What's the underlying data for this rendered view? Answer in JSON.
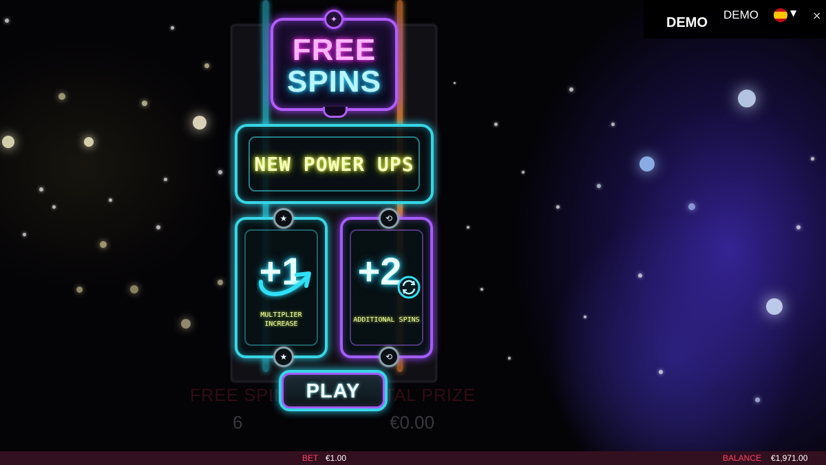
{
  "logo": {
    "line1": "FREE",
    "line2": "SPINS"
  },
  "panel": {
    "title": "NEW POWER UPS"
  },
  "cards": [
    {
      "value": "+1",
      "label_line1": "MULTIPLIER",
      "label_line2": "INCREASE",
      "icon": "arrow-up-icon",
      "badge_icon": "stars-icon"
    },
    {
      "value": "+2",
      "label_line1": "ADDITIONAL SPINS",
      "label_line2": "",
      "icon": "cycle-icon",
      "badge_icon": "cycle-icon"
    }
  ],
  "play_button": {
    "label": "PLAY"
  },
  "background_labels": {
    "free_spins": "FREE SPINS",
    "free_spins_value": "6",
    "total_prize": "TOTAL PRIZE",
    "total_prize_value": "€0.00"
  },
  "header": {
    "demo_badge": "DEMO",
    "demo_text": "DEMO",
    "language_flag": "spain-flag-icon",
    "caret": "▼",
    "close": "×"
  },
  "footer": {
    "bet_label": "BET",
    "bet_value": "€1.00",
    "balance_label": "BALANCE",
    "balance_value": "€1,971.00"
  },
  "colors": {
    "cyan_neon": "#37d6e6",
    "purple_neon": "#a45cff",
    "pink_neon": "#ff3cf2",
    "yellow_text": "#f2ffb0",
    "bet_red": "#ff3f63",
    "bottom_bar": "#33101f"
  }
}
